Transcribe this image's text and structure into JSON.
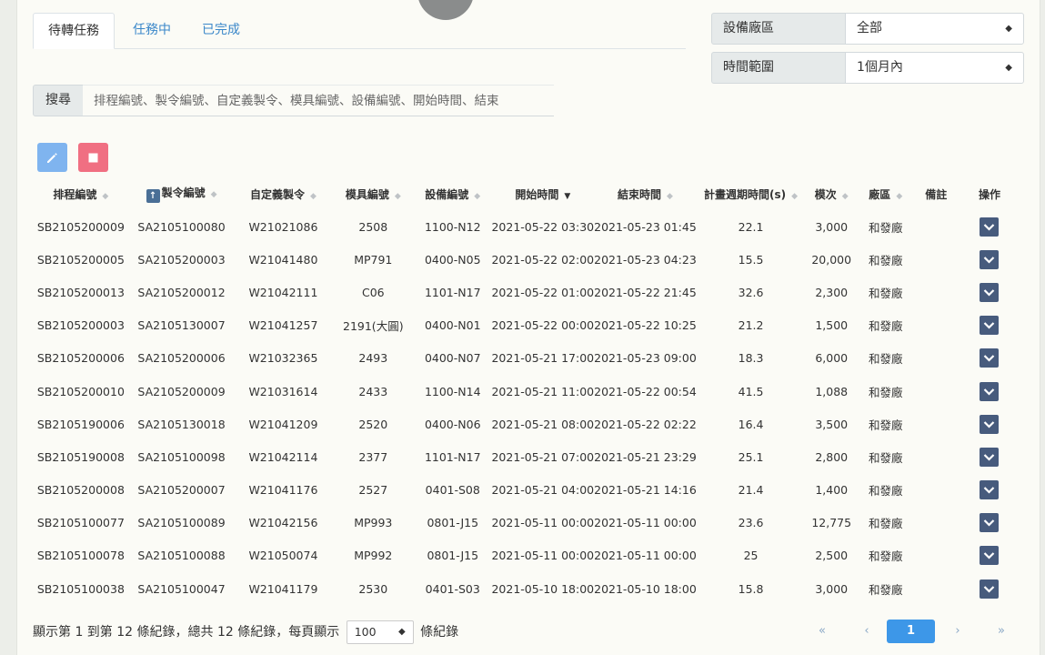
{
  "tabs": [
    {
      "label": "待轉任務",
      "active": true
    },
    {
      "label": "任務中",
      "active": false
    },
    {
      "label": "已完成",
      "active": false
    }
  ],
  "filters": {
    "plant": {
      "label": "設備廠區",
      "value": "全部"
    },
    "time_range": {
      "label": "時間範圍",
      "value": "1個月內"
    }
  },
  "search": {
    "label": "搜尋",
    "placeholder": "排程編號、製令編號、自定義製令、模具編號、設備編號、開始時間、結束"
  },
  "toolbar": {
    "edit_icon": "pencil-icon",
    "stop_icon": "stop-icon",
    "edit_color": "#7fb4ef",
    "stop_color": "#f06f82"
  },
  "table": {
    "headers": {
      "schedule_no": "排程編號",
      "order_no": "製令編號",
      "custom_order": "自定義製令",
      "mold_no": "模具編號",
      "equipment_no": "設備編號",
      "start_time": "開始時間",
      "end_time": "結束時間",
      "cycle_time": "計畫週期時間(s)",
      "shots": "模次",
      "plant": "廠區",
      "remark": "備註",
      "action": "操作"
    },
    "rows": [
      [
        "SB2105200009",
        "SA2105100080",
        "W21021086",
        "2508",
        "1100-N12",
        "2021-05-22 03:30",
        "2021-05-23 01:45",
        "22.1",
        "3,000",
        "和發廠",
        ""
      ],
      [
        "SB2105200005",
        "SA2105200003",
        "W21041480",
        "MP791",
        "0400-N05",
        "2021-05-22 02:00",
        "2021-05-23 04:23",
        "15.5",
        "20,000",
        "和發廠",
        ""
      ],
      [
        "SB2105200013",
        "SA2105200012",
        "W21042111",
        "C06",
        "1101-N17",
        "2021-05-22 01:00",
        "2021-05-22 21:45",
        "32.6",
        "2,300",
        "和發廠",
        ""
      ],
      [
        "SB2105200003",
        "SA2105130007",
        "W21041257",
        "2191(大圓)",
        "0400-N01",
        "2021-05-22 00:00",
        "2021-05-22 10:25",
        "21.2",
        "1,500",
        "和發廠",
        ""
      ],
      [
        "SB2105200006",
        "SA2105200006",
        "W21032365",
        "2493",
        "0400-N07",
        "2021-05-21 17:00",
        "2021-05-23 09:00",
        "18.3",
        "6,000",
        "和發廠",
        ""
      ],
      [
        "SB2105200010",
        "SA2105200009",
        "W21031614",
        "2433",
        "1100-N14",
        "2021-05-21 11:00",
        "2021-05-22 00:54",
        "41.5",
        "1,088",
        "和發廠",
        ""
      ],
      [
        "SB2105190006",
        "SA2105130018",
        "W21041209",
        "2520",
        "0400-N06",
        "2021-05-21 08:00",
        "2021-05-22 02:22",
        "16.4",
        "3,500",
        "和發廠",
        ""
      ],
      [
        "SB2105190008",
        "SA2105100098",
        "W21042114",
        "2377",
        "1101-N17",
        "2021-05-21 07:00",
        "2021-05-21 23:29",
        "25.1",
        "2,800",
        "和發廠",
        ""
      ],
      [
        "SB2105200008",
        "SA2105200007",
        "W21041176",
        "2527",
        "0401-S08",
        "2021-05-21 04:00",
        "2021-05-21 14:16",
        "21.4",
        "1,400",
        "和發廠",
        ""
      ],
      [
        "SB2105100077",
        "SA2105100089",
        "W21042156",
        "MP993",
        "0801-J15",
        "2021-05-11 00:00",
        "2021-05-11 00:00",
        "23.6",
        "12,775",
        "和發廠",
        ""
      ],
      [
        "SB2105100078",
        "SA2105100088",
        "W21050074",
        "MP992",
        "0801-J15",
        "2021-05-11 00:00",
        "2021-05-11 00:00",
        "25",
        "2,500",
        "和發廠",
        ""
      ],
      [
        "SB2105100038",
        "SA2105100047",
        "W21041179",
        "2530",
        "0401-S03",
        "2021-05-10 18:00",
        "2021-05-10 18:00",
        "15.8",
        "3,000",
        "和發廠",
        ""
      ]
    ]
  },
  "footer": {
    "summary_prefix": "顯示第 1 到第 12 條紀錄，總共 12 條紀錄，每頁顯示",
    "page_size": "100",
    "summary_suffix": "條紀錄"
  },
  "pagination": {
    "first": "«",
    "prev": "‹",
    "current": "1",
    "next": "›",
    "last": "»"
  }
}
